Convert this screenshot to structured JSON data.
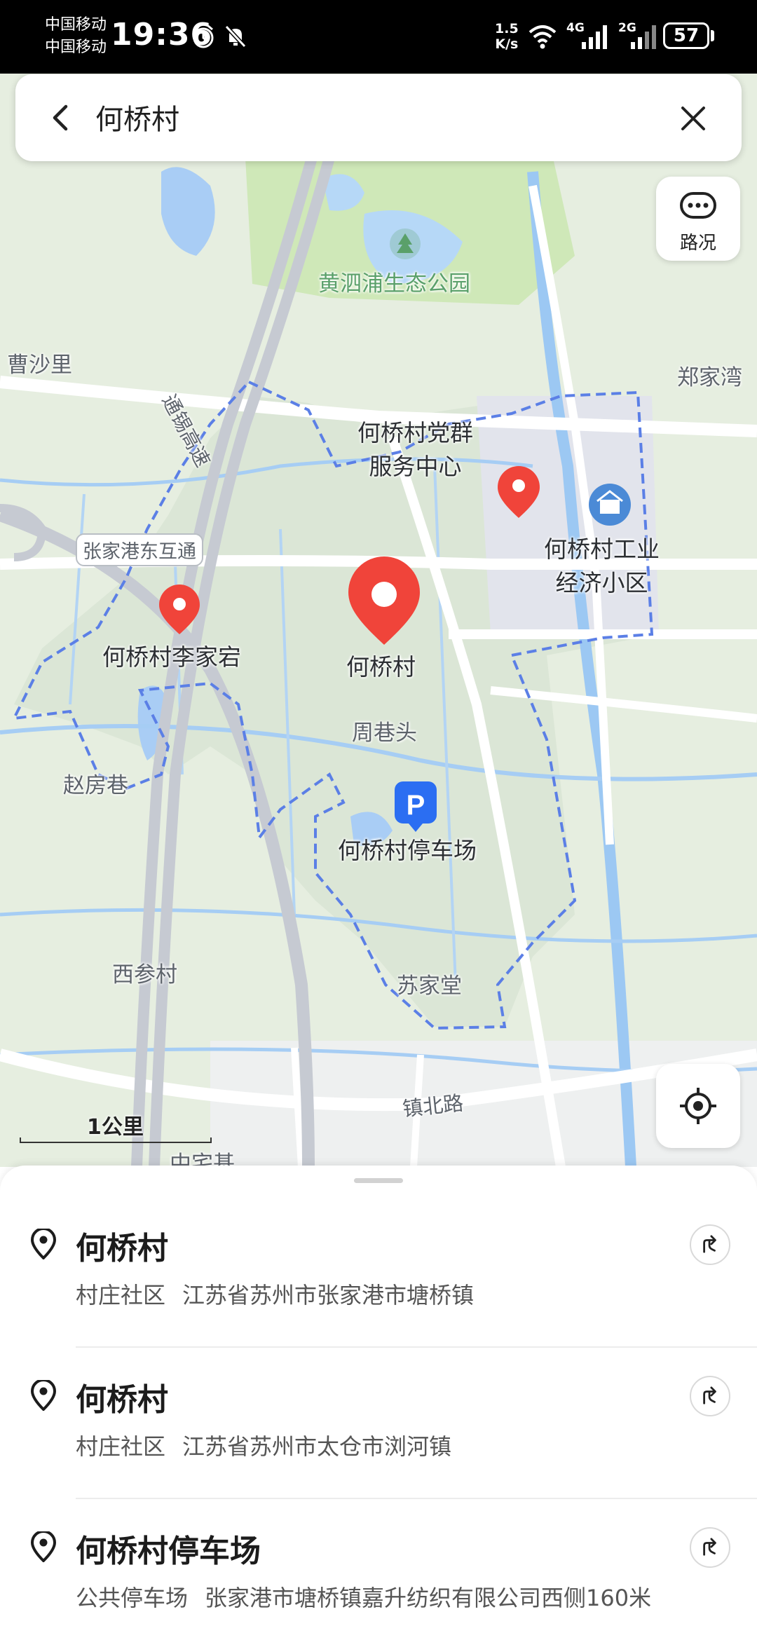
{
  "status_bar": {
    "carrier_1": "中国移动",
    "carrier_2": "中国移动",
    "time": "19:36",
    "net_speed_value": "1.5",
    "net_speed_unit": "K/s",
    "net_type_1": "4G",
    "net_type_2": "2G",
    "battery": "57"
  },
  "search": {
    "query": "何桥村"
  },
  "map": {
    "traffic_button_label": "路况",
    "scale_label": "1公里",
    "labels": {
      "park": "黄泗浦生态公园",
      "caoshali": "曹沙里",
      "zhengjiawan": "郑家湾",
      "expressway": "通锡高速",
      "interchange": "张家港东互通",
      "party_center_line1": "何桥村党群",
      "party_center_line2": "服务中心",
      "industrial_line1": "何桥村工业",
      "industrial_line2": "经济小区",
      "lijiahong": "何桥村李家宕",
      "heqiaocun": "何桥村",
      "zhouxiangtou": "周巷头",
      "zhaofangxiang": "赵房巷",
      "parking": "何桥村停车场",
      "xicancun": "西参村",
      "sujiatang": "苏家堂",
      "zhenbeilu": "镇北路",
      "zhongzhaiji": "中宅基"
    }
  },
  "results": [
    {
      "name": "何桥村",
      "category": "村庄社区",
      "address": "江苏省苏州市张家港市塘桥镇"
    },
    {
      "name": "何桥村",
      "category": "村庄社区",
      "address": "江苏省苏州市太仓市浏河镇"
    },
    {
      "name": "何桥村停车场",
      "category": "公共停车场",
      "address": "张家港市塘桥镇嘉升纺织有限公司西侧160米"
    }
  ],
  "colors": {
    "boundary": "#5b7fe6",
    "marker": "#f0443a",
    "parking": "#2b6ef2"
  }
}
